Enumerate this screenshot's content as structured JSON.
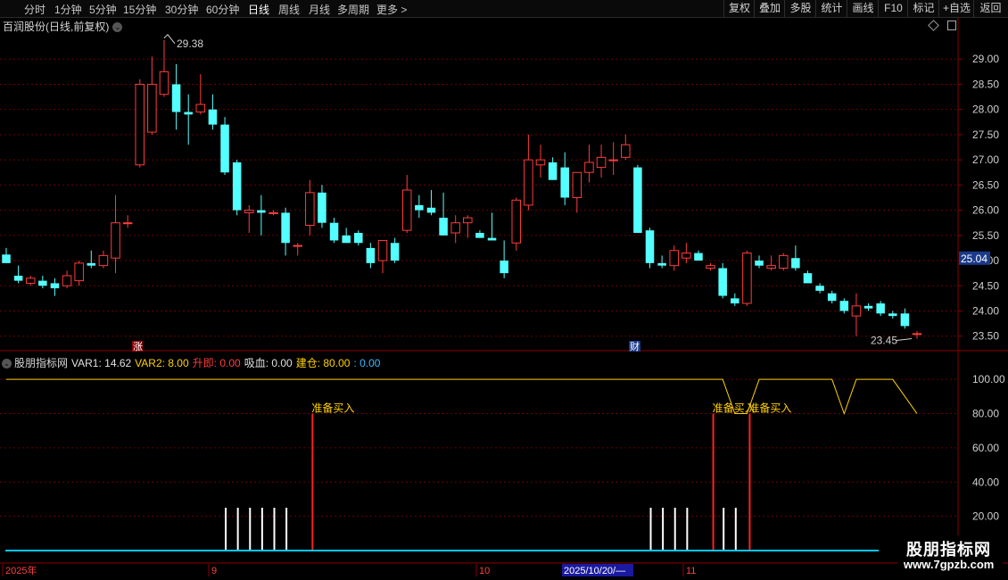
{
  "toolbar": {
    "periods": [
      "分时",
      "1分钟",
      "5分钟",
      "15分钟",
      "30分钟",
      "60分钟",
      "日线",
      "周线",
      "月线",
      "多周期",
      "更多 >"
    ],
    "active_period": "日线",
    "right_buttons": [
      "复权",
      "叠加",
      "多股",
      "统计",
      "画线",
      "F10",
      "标记",
      "+自选",
      "返回"
    ]
  },
  "header": {
    "stock_title": "百润股份(日线,前复权)",
    "dropdown_icon": "chevron-down-icon"
  },
  "price_axis": {
    "ticks": [
      "29.00",
      "28.50",
      "28.00",
      "27.50",
      "27.00",
      "26.50",
      "26.00",
      "25.50",
      "25.00",
      "24.50",
      "24.00",
      "23.50"
    ],
    "current_price": "25.04"
  },
  "annotations": {
    "high_label": "29.38",
    "low_label": "23.45",
    "zhang_marker": "涨",
    "cai_marker": "财"
  },
  "indicator": {
    "name": "股朋指标网",
    "var1": "VAR1: 14.62",
    "var2": "VAR2: 8.00",
    "shengji": "升即: 0.00",
    "xixue": "吸血: 0.00",
    "jiancang": "建仓: 80.00",
    "extra": ": 0.00",
    "axis_ticks": [
      "100.00",
      "80.00",
      "60.00",
      "40.00",
      "20.00"
    ],
    "signal_label": "准备买入"
  },
  "time_axis": {
    "labels": [
      "2025年",
      "9",
      "10",
      "2025/10/20/—",
      "11"
    ]
  },
  "watermark": {
    "line1": "股朋指标网",
    "line2": "www.7gpzb.com"
  },
  "colors": {
    "up": "#ff3b3b",
    "down": "#54ffff",
    "grid": "#6b0000",
    "panel_border": "#8b0000",
    "yellow": "#ffd000",
    "axis_text": "#d0d0d0"
  },
  "chart_data": {
    "type": "candlestick",
    "y_range": [
      23.3,
      29.5
    ],
    "candles": [
      {
        "o": 25.12,
        "h": 25.25,
        "l": 24.95,
        "c": 24.95
      },
      {
        "o": 24.7,
        "h": 24.9,
        "l": 24.55,
        "c": 24.6
      },
      {
        "o": 24.55,
        "h": 24.7,
        "l": 24.5,
        "c": 24.65
      },
      {
        "o": 24.6,
        "h": 24.7,
        "l": 24.45,
        "c": 24.5
      },
      {
        "o": 24.55,
        "h": 24.65,
        "l": 24.3,
        "c": 24.45
      },
      {
        "o": 24.5,
        "h": 24.8,
        "l": 24.45,
        "c": 24.7
      },
      {
        "o": 24.6,
        "h": 25.0,
        "l": 24.5,
        "c": 24.95
      },
      {
        "o": 24.95,
        "h": 25.2,
        "l": 24.85,
        "c": 24.9
      },
      {
        "o": 24.9,
        "h": 25.2,
        "l": 24.85,
        "c": 25.1
      },
      {
        "o": 25.05,
        "h": 26.3,
        "l": 24.75,
        "c": 25.75
      },
      {
        "o": 25.75,
        "h": 25.9,
        "l": 25.65,
        "c": 25.75
      },
      {
        "o": 26.9,
        "h": 28.6,
        "l": 26.85,
        "c": 28.5
      },
      {
        "o": 27.55,
        "h": 29.05,
        "l": 27.5,
        "c": 28.5
      },
      {
        "o": 28.3,
        "h": 29.38,
        "l": 28.25,
        "c": 28.75
      },
      {
        "o": 28.5,
        "h": 28.9,
        "l": 27.6,
        "c": 27.95
      },
      {
        "o": 27.95,
        "h": 28.3,
        "l": 27.3,
        "c": 27.9
      },
      {
        "o": 27.95,
        "h": 28.7,
        "l": 27.9,
        "c": 28.1
      },
      {
        "o": 28.0,
        "h": 28.3,
        "l": 27.6,
        "c": 27.7
      },
      {
        "o": 27.7,
        "h": 27.85,
        "l": 26.7,
        "c": 26.75
      },
      {
        "o": 26.95,
        "h": 27.0,
        "l": 25.9,
        "c": 26.0
      },
      {
        "o": 25.95,
        "h": 26.1,
        "l": 25.55,
        "c": 26.0
      },
      {
        "o": 26.0,
        "h": 26.3,
        "l": 25.5,
        "c": 25.95
      },
      {
        "o": 25.95,
        "h": 26.0,
        "l": 25.9,
        "c": 25.95
      },
      {
        "o": 25.95,
        "h": 26.05,
        "l": 25.1,
        "c": 25.35
      },
      {
        "o": 25.3,
        "h": 25.35,
        "l": 25.1,
        "c": 25.3
      },
      {
        "o": 25.7,
        "h": 26.6,
        "l": 25.5,
        "c": 26.35
      },
      {
        "o": 26.35,
        "h": 26.5,
        "l": 25.65,
        "c": 25.75
      },
      {
        "o": 25.75,
        "h": 25.85,
        "l": 25.35,
        "c": 25.4
      },
      {
        "o": 25.5,
        "h": 25.65,
        "l": 25.35,
        "c": 25.35
      },
      {
        "o": 25.55,
        "h": 25.6,
        "l": 25.3,
        "c": 25.35
      },
      {
        "o": 25.25,
        "h": 25.35,
        "l": 24.85,
        "c": 24.95
      },
      {
        "o": 25.0,
        "h": 25.4,
        "l": 24.75,
        "c": 25.4
      },
      {
        "o": 25.35,
        "h": 25.45,
        "l": 24.95,
        "c": 25.0
      },
      {
        "o": 25.6,
        "h": 26.7,
        "l": 25.55,
        "c": 26.4
      },
      {
        "o": 26.1,
        "h": 26.3,
        "l": 25.85,
        "c": 26.0
      },
      {
        "o": 26.05,
        "h": 26.4,
        "l": 25.9,
        "c": 25.95
      },
      {
        "o": 25.85,
        "h": 26.35,
        "l": 25.5,
        "c": 25.5
      },
      {
        "o": 25.55,
        "h": 25.9,
        "l": 25.35,
        "c": 25.75
      },
      {
        "o": 25.75,
        "h": 25.9,
        "l": 25.45,
        "c": 25.85
      },
      {
        "o": 25.55,
        "h": 25.6,
        "l": 25.45,
        "c": 25.45
      },
      {
        "o": 25.45,
        "h": 25.95,
        "l": 25.4,
        "c": 25.4
      },
      {
        "o": 25.0,
        "h": 25.4,
        "l": 24.65,
        "c": 24.75
      },
      {
        "o": 25.35,
        "h": 26.25,
        "l": 25.2,
        "c": 26.2
      },
      {
        "o": 26.1,
        "h": 27.5,
        "l": 26.0,
        "c": 27.0
      },
      {
        "o": 26.9,
        "h": 27.3,
        "l": 26.65,
        "c": 27.0
      },
      {
        "o": 26.95,
        "h": 27.05,
        "l": 26.6,
        "c": 26.6
      },
      {
        "o": 26.85,
        "h": 27.15,
        "l": 26.1,
        "c": 26.25
      },
      {
        "o": 26.25,
        "h": 26.7,
        "l": 25.95,
        "c": 26.75
      },
      {
        "o": 26.75,
        "h": 27.3,
        "l": 26.55,
        "c": 26.95
      },
      {
        "o": 26.85,
        "h": 27.3,
        "l": 26.65,
        "c": 27.05
      },
      {
        "o": 27.0,
        "h": 27.35,
        "l": 26.7,
        "c": 27.0
      },
      {
        "o": 27.05,
        "h": 27.5,
        "l": 27.0,
        "c": 27.3
      },
      {
        "o": 26.85,
        "h": 26.9,
        "l": 26.45,
        "c": 25.55
      },
      {
        "o": 25.6,
        "h": 25.65,
        "l": 24.85,
        "c": 24.95
      },
      {
        "o": 24.95,
        "h": 25.1,
        "l": 24.85,
        "c": 24.9
      },
      {
        "o": 24.9,
        "h": 25.3,
        "l": 24.8,
        "c": 25.2
      },
      {
        "o": 25.05,
        "h": 25.35,
        "l": 24.95,
        "c": 25.15
      },
      {
        "o": 25.15,
        "h": 25.2,
        "l": 25.0,
        "c": 25.0
      },
      {
        "o": 24.85,
        "h": 24.95,
        "l": 24.8,
        "c": 24.9
      },
      {
        "o": 24.85,
        "h": 24.95,
        "l": 24.25,
        "c": 24.3
      },
      {
        "o": 24.25,
        "h": 24.35,
        "l": 24.1,
        "c": 24.15
      },
      {
        "o": 24.15,
        "h": 25.2,
        "l": 24.1,
        "c": 25.15
      },
      {
        "o": 25.0,
        "h": 25.1,
        "l": 24.85,
        "c": 24.9
      },
      {
        "o": 24.85,
        "h": 25.1,
        "l": 24.8,
        "c": 24.9
      },
      {
        "o": 24.85,
        "h": 25.15,
        "l": 24.8,
        "c": 25.1
      },
      {
        "o": 25.05,
        "h": 25.3,
        "l": 24.8,
        "c": 24.85
      },
      {
        "o": 24.75,
        "h": 24.8,
        "l": 24.55,
        "c": 24.55
      },
      {
        "o": 24.5,
        "h": 24.55,
        "l": 24.35,
        "c": 24.4
      },
      {
        "o": 24.35,
        "h": 24.4,
        "l": 24.15,
        "c": 24.2
      },
      {
        "o": 24.2,
        "h": 24.25,
        "l": 23.95,
        "c": 24.0
      },
      {
        "o": 23.9,
        "h": 24.35,
        "l": 23.5,
        "c": 24.1
      },
      {
        "o": 24.1,
        "h": 24.15,
        "l": 24.0,
        "c": 24.05
      },
      {
        "o": 24.15,
        "h": 24.2,
        "l": 23.9,
        "c": 23.95
      },
      {
        "o": 23.95,
        "h": 24.0,
        "l": 23.85,
        "c": 23.9
      },
      {
        "o": 23.95,
        "h": 24.05,
        "l": 23.65,
        "c": 23.7
      },
      {
        "o": 23.55,
        "h": 23.6,
        "l": 23.45,
        "c": 23.55
      }
    ],
    "indicator_series": {
      "name": "建仓",
      "y_range": [
        0,
        110
      ],
      "values_at": [
        {
          "i": 0,
          "v": 100
        },
        {
          "i": 59,
          "v": 100
        },
        {
          "i": 60,
          "v": 80
        },
        {
          "i": 61,
          "v": 80
        },
        {
          "i": 62,
          "v": 100
        },
        {
          "i": 68,
          "v": 100
        },
        {
          "i": 69,
          "v": 80
        },
        {
          "i": 70,
          "v": 100
        },
        {
          "i": 73,
          "v": 100
        },
        {
          "i": 75,
          "v": 80
        }
      ]
    },
    "white_bars_idx": [
      18,
      19,
      20,
      21,
      22,
      23,
      53,
      54,
      55,
      56,
      59,
      60
    ],
    "red_signal_idx": [
      25,
      58,
      61
    ],
    "white_bar_value": 25
  }
}
